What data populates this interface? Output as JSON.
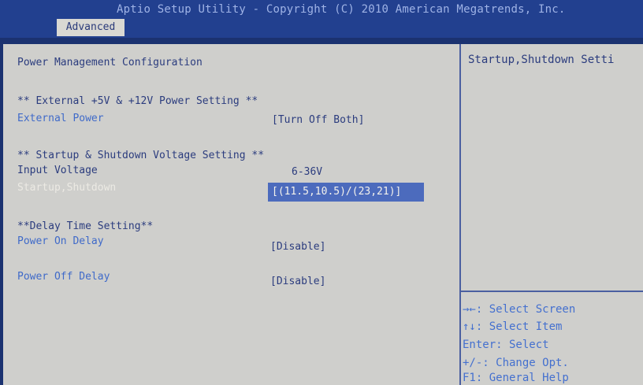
{
  "header": {
    "title": "Aptio Setup Utility - Copyright (C) 2010 American Megatrends, Inc.",
    "tab_label": "Advanced"
  },
  "main": {
    "page_title": "Power Management Configuration",
    "section_external": "** External +5V & +12V Power Setting **",
    "external_power": {
      "label": "External Power",
      "value": "[Turn Off Both]"
    },
    "section_voltage": "** Startup & Shutdown Voltage Setting **",
    "input_voltage": {
      "label": "Input Voltage",
      "value": "6-36V"
    },
    "startup_shutdown": {
      "label": "Startup,Shutdown",
      "value": "[(11.5,10.5)/(23,21)]"
    },
    "section_delay": "**Delay Time Setting**",
    "power_on_delay": {
      "label": "Power On Delay",
      "value": "[Disable]"
    },
    "power_off_delay": {
      "label": "Power Off Delay",
      "value": "[Disable]"
    }
  },
  "help_panel": {
    "item_help": "Startup,Shutdown Setti",
    "keys": [
      "→←: Select Screen",
      "↑↓: Select Item",
      "Enter: Select",
      "+/-: Change Opt.",
      "F1: General Help"
    ]
  },
  "colors": {
    "background": "#1b3270",
    "panel": "#cfcfcc",
    "tab": "#d9d8d3",
    "selection": "#4c6bbd",
    "item_text": "#3f6ac9",
    "static_text": "#2b3c7e"
  }
}
